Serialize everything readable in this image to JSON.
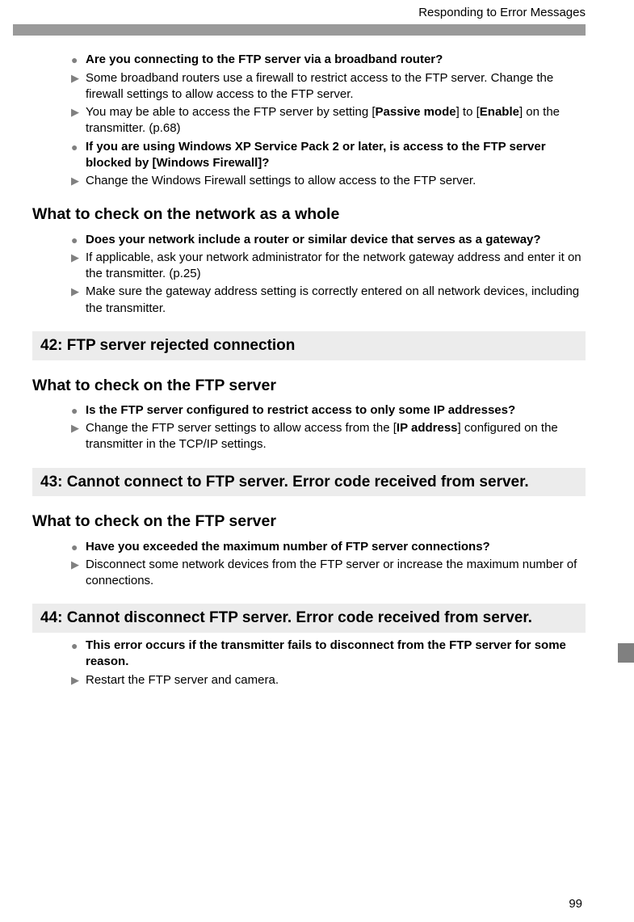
{
  "runningHead": "Responding to Error Messages",
  "pageNumber": "99",
  "block1": {
    "items": [
      {
        "type": "dot",
        "segs": [
          {
            "b": true,
            "t": "Are you connecting to the FTP server via a broadband router?"
          }
        ]
      },
      {
        "type": "tri",
        "segs": [
          {
            "b": false,
            "t": "Some broadband routers use a firewall to restrict access to the FTP server. Change the firewall settings to allow access to the FTP server."
          }
        ]
      },
      {
        "type": "tri",
        "segs": [
          {
            "b": false,
            "t": "You may be able to access the FTP server by setting ["
          },
          {
            "b": true,
            "t": "Passive mode"
          },
          {
            "b": false,
            "t": "] to ["
          },
          {
            "b": true,
            "t": "Enable"
          },
          {
            "b": false,
            "t": "] on the transmitter. (p.68)"
          }
        ]
      },
      {
        "type": "dot",
        "segs": [
          {
            "b": true,
            "t": "If you are using Windows XP Service Pack 2 or later, is access to the FTP server blocked by [Windows Firewall]?"
          }
        ]
      },
      {
        "type": "tri",
        "segs": [
          {
            "b": false,
            "t": "Change the Windows Firewall settings to allow access to the FTP server."
          }
        ]
      }
    ]
  },
  "h2_network": "What to check on the network as a whole",
  "block2": {
    "items": [
      {
        "type": "dot",
        "segs": [
          {
            "b": true,
            "t": "Does your network include a router or similar device that serves as a gateway?"
          }
        ]
      },
      {
        "type": "tri",
        "segs": [
          {
            "b": false,
            "t": "If applicable, ask your network administrator for the network gateway address and enter it on the transmitter. (p.25)"
          }
        ]
      },
      {
        "type": "tri",
        "segs": [
          {
            "b": false,
            "t": "Make sure the gateway address setting is correctly entered on all network devices, including the transmitter."
          }
        ]
      }
    ]
  },
  "err42": "42:  FTP server rejected connection",
  "h2_ftp42": "What to check on the FTP server",
  "block3": {
    "items": [
      {
        "type": "dot",
        "segs": [
          {
            "b": true,
            "t": "Is the FTP server configured to restrict access to only some IP addresses?"
          }
        ]
      },
      {
        "type": "tri",
        "segs": [
          {
            "b": false,
            "t": "Change the FTP server settings to allow access from the ["
          },
          {
            "b": true,
            "t": "IP address"
          },
          {
            "b": false,
            "t": "] configured on the transmitter in the TCP/IP settings."
          }
        ]
      }
    ]
  },
  "err43": "43:  Cannot connect to FTP server. Error code received from server.",
  "h2_ftp43": "What to check on the FTP server",
  "block4": {
    "items": [
      {
        "type": "dot",
        "segs": [
          {
            "b": true,
            "t": "Have you exceeded the maximum number of FTP server connections?"
          }
        ]
      },
      {
        "type": "tri",
        "segs": [
          {
            "b": false,
            "t": "Disconnect some network devices from the FTP server or increase the maximum number of connections."
          }
        ]
      }
    ]
  },
  "err44": "44:  Cannot disconnect FTP server. Error code received from server.",
  "block5": {
    "items": [
      {
        "type": "dot",
        "segs": [
          {
            "b": true,
            "t": "This error occurs if the transmitter fails to disconnect from the FTP server for some reason."
          }
        ]
      },
      {
        "type": "tri",
        "segs": [
          {
            "b": false,
            "t": "Restart the FTP server and camera."
          }
        ]
      }
    ]
  }
}
